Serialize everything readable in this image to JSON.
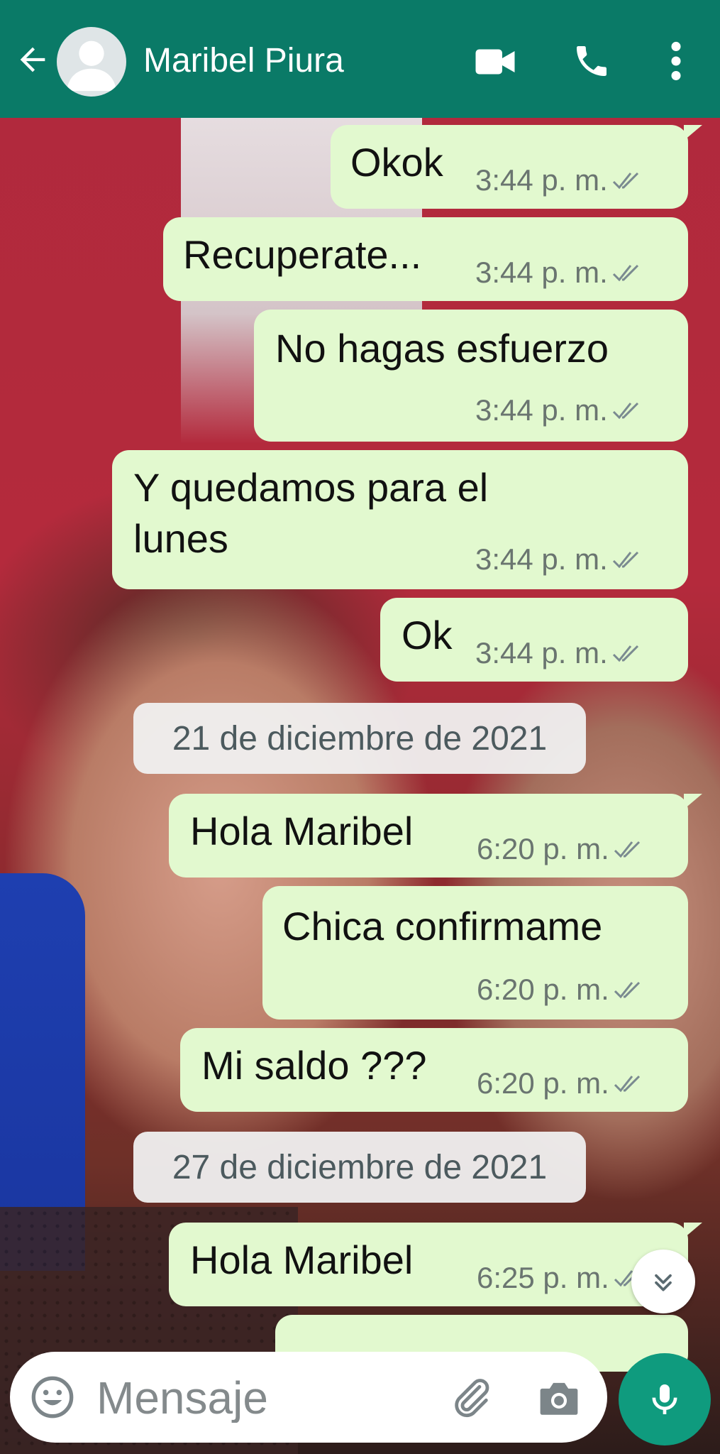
{
  "header": {
    "contact_name": "Maribel Piura"
  },
  "messages": [
    {
      "text": "Okok",
      "time": "3:44 p. m."
    },
    {
      "text": "Recuperate...",
      "time": "3:44 p. m."
    },
    {
      "text": "No hagas esfuerzo",
      "time": "3:44 p. m."
    },
    {
      "text_line1": "Y quedamos para el",
      "text_line2": "lunes",
      "time": "3:44 p. m."
    },
    {
      "text": "Ok",
      "time": "3:44 p. m."
    },
    {
      "date": "21 de diciembre de 2021"
    },
    {
      "text": "Hola Maribel",
      "time": "6:20 p. m."
    },
    {
      "text": "Chica confirmame",
      "time": "6:20 p. m."
    },
    {
      "text": "Mi saldo ???",
      "time": "6:20 p. m."
    },
    {
      "date": "27 de diciembre de 2021"
    },
    {
      "text": "Hola Maribel",
      "time": "6:25 p. m."
    }
  ],
  "composer": {
    "placeholder": "Mensaje"
  },
  "colors": {
    "header": "#0a7a67",
    "outgoing_bubble": "#e2f9cf",
    "mic_button": "#0f9b7e"
  },
  "icons": [
    "back-arrow-icon",
    "avatar-placeholder-icon",
    "video-call-icon",
    "phone-icon",
    "more-vert-icon",
    "double-check-icon",
    "scroll-down-icon",
    "emoji-icon",
    "attach-icon",
    "camera-icon",
    "mic-icon"
  ]
}
